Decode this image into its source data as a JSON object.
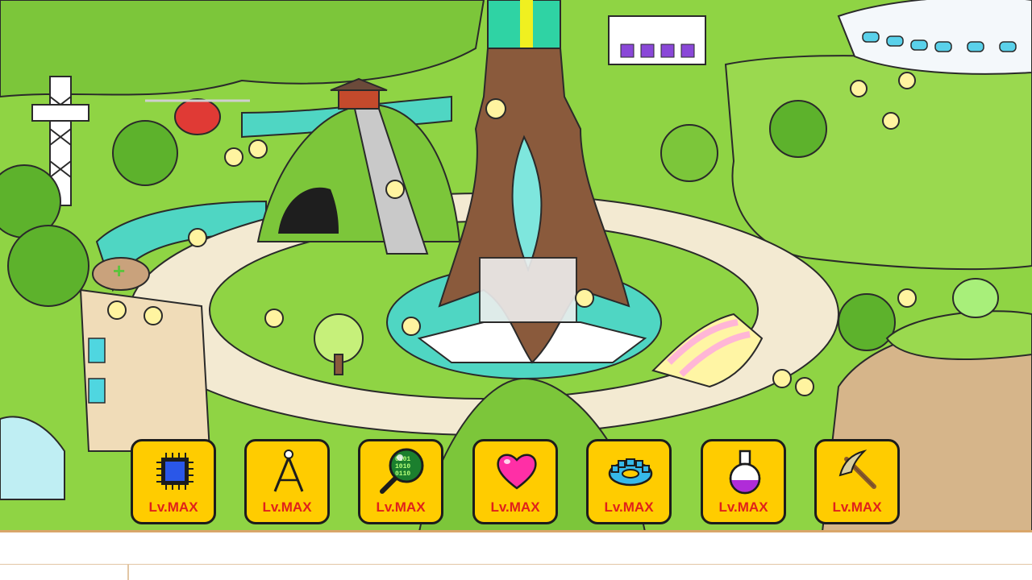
{
  "game": {
    "upgrades": [
      {
        "icon": "cpu-chip-icon",
        "level": "Lv.MAX"
      },
      {
        "icon": "drafting-compass-icon",
        "level": "Lv.MAX"
      },
      {
        "icon": "binary-magnifier-icon",
        "level": "Lv.MAX"
      },
      {
        "icon": "heart-icon",
        "level": "Lv.MAX"
      },
      {
        "icon": "gear-icon",
        "level": "Lv.MAX"
      },
      {
        "icon": "potion-flask-icon",
        "level": "Lv.MAX"
      },
      {
        "icon": "pickaxe-icon",
        "level": "Lv.MAX"
      }
    ],
    "colors": {
      "button_bg": "#ffcc00",
      "level_text": "#e0211b",
      "grass": "#8fd444",
      "path": "#f3ead2",
      "water": "#4fd6c3",
      "tree_trunk": "#8a5a3c"
    }
  }
}
